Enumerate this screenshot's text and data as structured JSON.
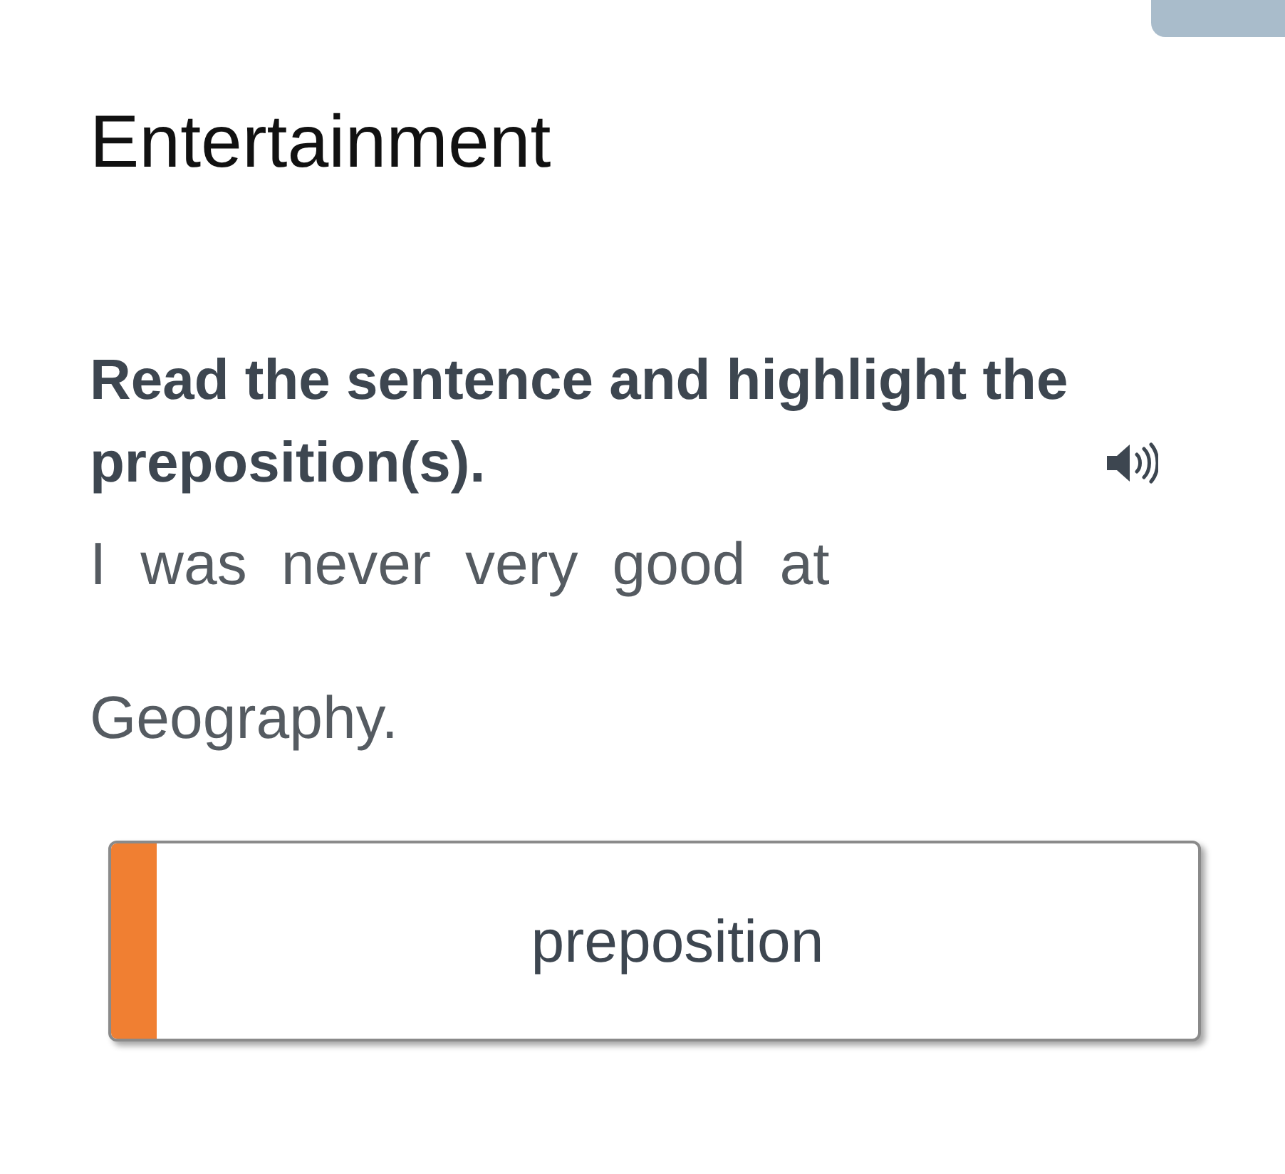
{
  "title": "Entertainment",
  "instruction": "Read the sentence and highlight the preposition(s).",
  "words": [
    {
      "text": "I",
      "selected": false
    },
    {
      "text": "was",
      "selected": false
    },
    {
      "text": "never",
      "selected": false
    },
    {
      "text": "very",
      "selected": false
    },
    {
      "text": "good",
      "selected": false
    },
    {
      "text": "at",
      "selected": false
    },
    {
      "text": "Geography.",
      "selected": false
    }
  ],
  "answer_button": {
    "label": "preposition",
    "color": "#f07f32"
  }
}
